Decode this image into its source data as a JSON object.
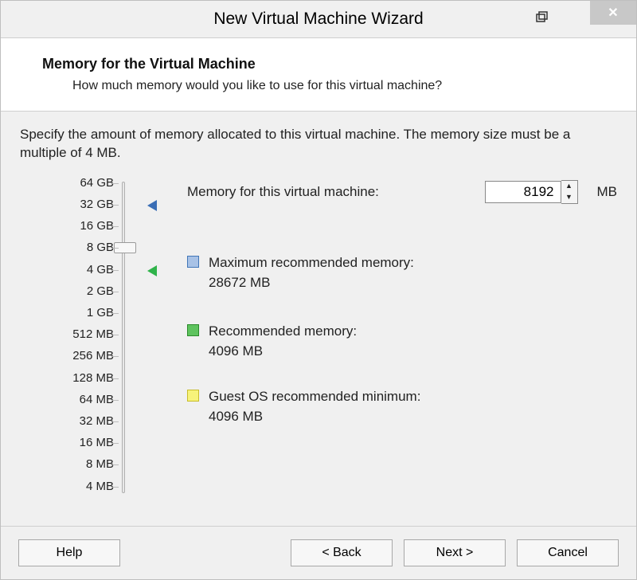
{
  "title": "New Virtual Machine Wizard",
  "header": {
    "heading": "Memory for the Virtual Machine",
    "sub": "How much memory would you like to use for this virtual machine?"
  },
  "instruction": "Specify the amount of memory allocated to this virtual machine. The memory size must be a multiple of 4 MB.",
  "mem_label": "Memory for this virtual machine:",
  "mem_value": "8192",
  "mem_unit": "MB",
  "ticks": [
    "64 GB",
    "32 GB",
    "16 GB",
    "8 GB",
    "4 GB",
    "2 GB",
    "1 GB",
    "512 MB",
    "256 MB",
    "128 MB",
    "64 MB",
    "32 MB",
    "16 MB",
    "8 MB",
    "4 MB"
  ],
  "recs": {
    "max": {
      "label": "Maximum recommended memory:",
      "value": "28672 MB"
    },
    "rec": {
      "label": "Recommended memory:",
      "value": "4096 MB"
    },
    "min": {
      "label": "Guest OS recommended minimum:",
      "value": "4096 MB"
    }
  },
  "buttons": {
    "help": "Help",
    "back": "< Back",
    "next": "Next >",
    "cancel": "Cancel"
  }
}
